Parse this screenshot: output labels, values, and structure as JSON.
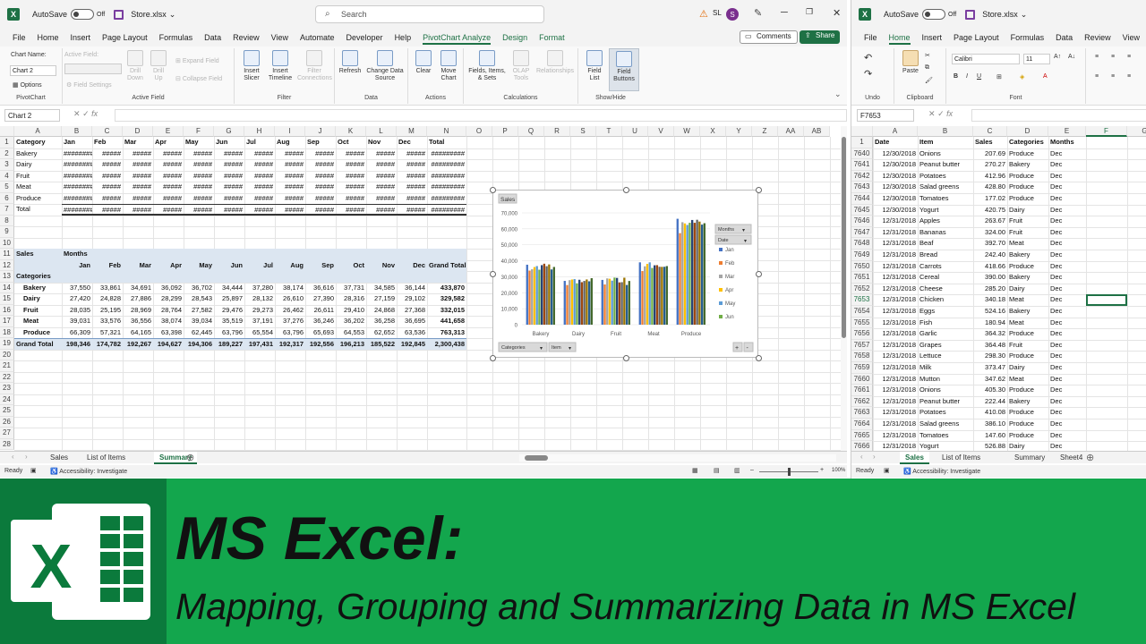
{
  "left": {
    "autosave_label": "AutoSave",
    "autosave_state": "Off",
    "filename": "Store.xlsx",
    "search_placeholder": "Search",
    "user_initials": "SL",
    "avatar_letter": "S",
    "menus": [
      "File",
      "Home",
      "Insert",
      "Page Layout",
      "Formulas",
      "Data",
      "Review",
      "View",
      "Automate",
      "Developer",
      "Help",
      "PivotChart Analyze",
      "Design",
      "Format"
    ],
    "comments_label": "Comments",
    "share_label": "Share",
    "ribbon": {
      "chart_name_label": "Chart Name:",
      "chart_name_value": "Chart 2",
      "active_field_label": "Active Field:",
      "options_label": "Options",
      "field_settings_label": "Field Settings",
      "drill_down": "Drill Down",
      "drill_up": "Drill Up",
      "expand_field": "Expand Field",
      "collapse_field": "Collapse Field",
      "insert_slicer": "Insert Slicer",
      "insert_timeline": "Insert Timeline",
      "filter_connections": "Filter Connections",
      "refresh": "Refresh",
      "change_data_source": "Change Data Source",
      "clear": "Clear",
      "move_chart": "Move Chart",
      "fields_items_sets": "Fields, Items, & Sets",
      "olap_tools": "OLAP Tools",
      "relationships": "Relationships",
      "field_list": "Field List",
      "field_buttons": "Field Buttons",
      "groups": {
        "pivotchart": "PivotChart",
        "active_field": "Active Field",
        "filter": "Filter",
        "data": "Data",
        "actions": "Actions",
        "calculations": "Calculations",
        "show_hide": "Show/Hide"
      }
    },
    "namebox": "Chart 2",
    "fx": "fx",
    "columns": [
      "A",
      "B",
      "C",
      "D",
      "E",
      "F",
      "G",
      "H",
      "I",
      "J",
      "K",
      "L",
      "M",
      "N",
      "O",
      "P",
      "Q",
      "R",
      "S",
      "T",
      "U",
      "V",
      "W",
      "X",
      "Y",
      "Z",
      "AA",
      "AB"
    ],
    "rows": [
      "1",
      "2",
      "3",
      "4",
      "5",
      "6",
      "7",
      "8",
      "9",
      "10",
      "11",
      "12",
      "13",
      "14",
      "15",
      "16",
      "17",
      "18",
      "19",
      "20",
      "21",
      "22",
      "23",
      "24",
      "25",
      "26",
      "27",
      "28"
    ],
    "top_table": {
      "headers": [
        "Category",
        "Jan",
        "Feb",
        "Mar",
        "Apr",
        "May",
        "Jun",
        "Jul",
        "Aug",
        "Sep",
        "Oct",
        "Nov",
        "Dec",
        "Total"
      ],
      "categories": [
        "Bakery",
        "Dairy",
        "Fruit",
        "Meat",
        "Produce",
        "Total"
      ],
      "hash_wide": "########",
      "hash_narrow": "#####",
      "hash_total": "#########"
    },
    "pivot": {
      "values_label": "Sales",
      "columns_label": "Months",
      "rows_label": "Categories",
      "months": [
        "Jan",
        "Feb",
        "Mar",
        "Apr",
        "May",
        "Jun",
        "Jul",
        "Aug",
        "Sep",
        "Oct",
        "Nov",
        "Dec"
      ],
      "grand_total_label": "Grand Total",
      "rows": [
        {
          "label": "Bakery",
          "values": [
            "37,550",
            "33,861",
            "34,691",
            "36,092",
            "36,702",
            "34,444",
            "37,280",
            "38,174",
            "36,616",
            "37,731",
            "34,585",
            "36,144",
            "433,870"
          ]
        },
        {
          "label": "Dairy",
          "values": [
            "27,420",
            "24,828",
            "27,886",
            "28,299",
            "28,543",
            "25,897",
            "28,132",
            "26,610",
            "27,390",
            "28,316",
            "27,159",
            "29,102",
            "329,582"
          ]
        },
        {
          "label": "Fruit",
          "values": [
            "28,035",
            "25,195",
            "28,969",
            "28,764",
            "27,582",
            "29,476",
            "29,273",
            "26,462",
            "26,611",
            "29,410",
            "24,868",
            "27,368",
            "332,015"
          ]
        },
        {
          "label": "Meat",
          "values": [
            "39,031",
            "33,576",
            "36,556",
            "38,074",
            "39,034",
            "35,519",
            "37,191",
            "37,276",
            "36,246",
            "36,202",
            "36,258",
            "36,695",
            "441,658"
          ]
        },
        {
          "label": "Produce",
          "values": [
            "66,309",
            "57,321",
            "64,165",
            "63,398",
            "62,445",
            "63,796",
            "65,554",
            "63,796",
            "65,693",
            "64,553",
            "62,652",
            "63,536",
            "763,313"
          ]
        }
      ],
      "grand_total": [
        "198,346",
        "174,782",
        "192,267",
        "194,627",
        "194,306",
        "189,227",
        "197,431",
        "192,317",
        "192,556",
        "196,213",
        "185,522",
        "192,845",
        "2,300,438"
      ]
    },
    "chart_data": {
      "type": "bar",
      "title": "Sales",
      "categories": [
        "Bakery",
        "Dairy",
        "Fruit",
        "Meat",
        "Produce"
      ],
      "ylim": [
        0,
        70000
      ],
      "yticks": [
        "0",
        "10,000",
        "20,000",
        "30,000",
        "40,000",
        "50,000",
        "60,000",
        "70,000"
      ],
      "legend_title": "Months",
      "legend_subtitle": "Date",
      "legend_placement": "right",
      "legend_items": [
        "Jan",
        "Feb",
        "Mar",
        "Apr",
        "May",
        "Jun"
      ],
      "bottom_buttons": [
        "Categories",
        "Item"
      ],
      "series": [
        {
          "name": "Jan",
          "values": [
            37550,
            27420,
            28035,
            39031,
            66309
          ]
        },
        {
          "name": "Feb",
          "values": [
            33861,
            24828,
            25195,
            33576,
            57321
          ]
        },
        {
          "name": "Mar",
          "values": [
            34691,
            27886,
            28969,
            36556,
            64165
          ]
        },
        {
          "name": "Apr",
          "values": [
            36092,
            28299,
            28764,
            38074,
            63398
          ]
        },
        {
          "name": "May",
          "values": [
            36702,
            28543,
            27582,
            39034,
            62445
          ]
        },
        {
          "name": "Jun",
          "values": [
            34444,
            25897,
            29476,
            35519,
            63796
          ]
        },
        {
          "values": [
            37280,
            28132,
            29273,
            37191,
            65554
          ]
        },
        {
          "values": [
            38174,
            26610,
            26462,
            37276,
            63796
          ]
        },
        {
          "values": [
            36616,
            27390,
            26611,
            36246,
            65693
          ]
        },
        {
          "values": [
            37731,
            28316,
            29410,
            36202,
            64553
          ]
        },
        {
          "values": [
            34585,
            27159,
            24868,
            36258,
            62652
          ]
        },
        {
          "values": [
            36144,
            29102,
            27368,
            36695,
            63536
          ]
        }
      ],
      "colors": [
        "#4472c4",
        "#ed7d31",
        "#a5a5a5",
        "#ffc000",
        "#5b9bd5",
        "#70ad47",
        "#264478",
        "#9e480e",
        "#636363",
        "#997300",
        "#255e91",
        "#43682b"
      ]
    },
    "sheet_tabs": [
      "Sales",
      "List of Items",
      "Summary"
    ],
    "active_tab": "Summary",
    "status_ready": "Ready",
    "status_accessibility": "Accessibility: Investigate",
    "zoom": "100%"
  },
  "right": {
    "autosave_label": "AutoSave",
    "autosave_state": "Off",
    "filename": "Store.xlsx",
    "menus": [
      "File",
      "Home",
      "Insert",
      "Page Layout",
      "Formulas",
      "Data",
      "Review",
      "View"
    ],
    "ribbon": {
      "undo": "Undo",
      "clipboard": "Clipboard",
      "font": "Font",
      "paste": "Paste",
      "font_name": "Calibri",
      "font_size": "11"
    },
    "namebox": "F7653",
    "fx": "fx",
    "columns": [
      "A",
      "B",
      "C",
      "D",
      "E",
      "F",
      "G"
    ],
    "headers": [
      "Date",
      "Item",
      "Sales",
      "Categories",
      "Months"
    ],
    "header_row": "1",
    "rows": [
      [
        "7640",
        "12/30/2018",
        "Onions",
        "207.69",
        "Produce",
        "Dec"
      ],
      [
        "7641",
        "12/30/2018",
        "Peanut butter",
        "270.27",
        "Bakery",
        "Dec"
      ],
      [
        "7642",
        "12/30/2018",
        "Potatoes",
        "412.96",
        "Produce",
        "Dec"
      ],
      [
        "7643",
        "12/30/2018",
        "Salad greens",
        "428.80",
        "Produce",
        "Dec"
      ],
      [
        "7644",
        "12/30/2018",
        "Tomatoes",
        "177.02",
        "Produce",
        "Dec"
      ],
      [
        "7645",
        "12/30/2018",
        "Yogurt",
        "420.75",
        "Dairy",
        "Dec"
      ],
      [
        "7646",
        "12/31/2018",
        "Apples",
        "263.67",
        "Fruit",
        "Dec"
      ],
      [
        "7647",
        "12/31/2018",
        "Bananas",
        "324.00",
        "Fruit",
        "Dec"
      ],
      [
        "7648",
        "12/31/2018",
        "Beaf",
        "392.70",
        "Meat",
        "Dec"
      ],
      [
        "7649",
        "12/31/2018",
        "Bread",
        "242.40",
        "Bakery",
        "Dec"
      ],
      [
        "7650",
        "12/31/2018",
        "Carrots",
        "418.66",
        "Produce",
        "Dec"
      ],
      [
        "7651",
        "12/31/2018",
        "Cereal",
        "390.00",
        "Bakery",
        "Dec"
      ],
      [
        "7652",
        "12/31/2018",
        "Cheese",
        "285.20",
        "Dairy",
        "Dec"
      ],
      [
        "7653",
        "12/31/2018",
        "Chicken",
        "340.18",
        "Meat",
        "Dec"
      ],
      [
        "7654",
        "12/31/2018",
        "Eggs",
        "524.16",
        "Bakery",
        "Dec"
      ],
      [
        "7655",
        "12/31/2018",
        "Fish",
        "180.94",
        "Meat",
        "Dec"
      ],
      [
        "7656",
        "12/31/2018",
        "Garlic",
        "364.32",
        "Produce",
        "Dec"
      ],
      [
        "7657",
        "12/31/2018",
        "Grapes",
        "364.48",
        "Fruit",
        "Dec"
      ],
      [
        "7658",
        "12/31/2018",
        "Lettuce",
        "298.30",
        "Produce",
        "Dec"
      ],
      [
        "7659",
        "12/31/2018",
        "Milk",
        "373.47",
        "Dairy",
        "Dec"
      ],
      [
        "7660",
        "12/31/2018",
        "Mutton",
        "347.62",
        "Meat",
        "Dec"
      ],
      [
        "7661",
        "12/31/2018",
        "Onions",
        "405.30",
        "Produce",
        "Dec"
      ],
      [
        "7662",
        "12/31/2018",
        "Peanut butter",
        "222.44",
        "Bakery",
        "Dec"
      ],
      [
        "7663",
        "12/31/2018",
        "Potatoes",
        "410.08",
        "Produce",
        "Dec"
      ],
      [
        "7664",
        "12/31/2018",
        "Salad greens",
        "386.10",
        "Produce",
        "Dec"
      ],
      [
        "7665",
        "12/31/2018",
        "Tomatoes",
        "147.60",
        "Produce",
        "Dec"
      ],
      [
        "7666",
        "12/31/2018",
        "Yogurt",
        "526.88",
        "Dairy",
        "Dec"
      ]
    ],
    "sheet_tabs": [
      "Sales",
      "List of Items",
      "Summary",
      "Sheet4"
    ],
    "active_tab": "Sales",
    "status_ready": "Ready",
    "status_accessibility": "Accessibility: Investigate"
  },
  "banner": {
    "title": "MS Excel:",
    "subtitle": "Mapping, Grouping and Summarizing Data in MS Excel",
    "logo_letter": "X"
  }
}
